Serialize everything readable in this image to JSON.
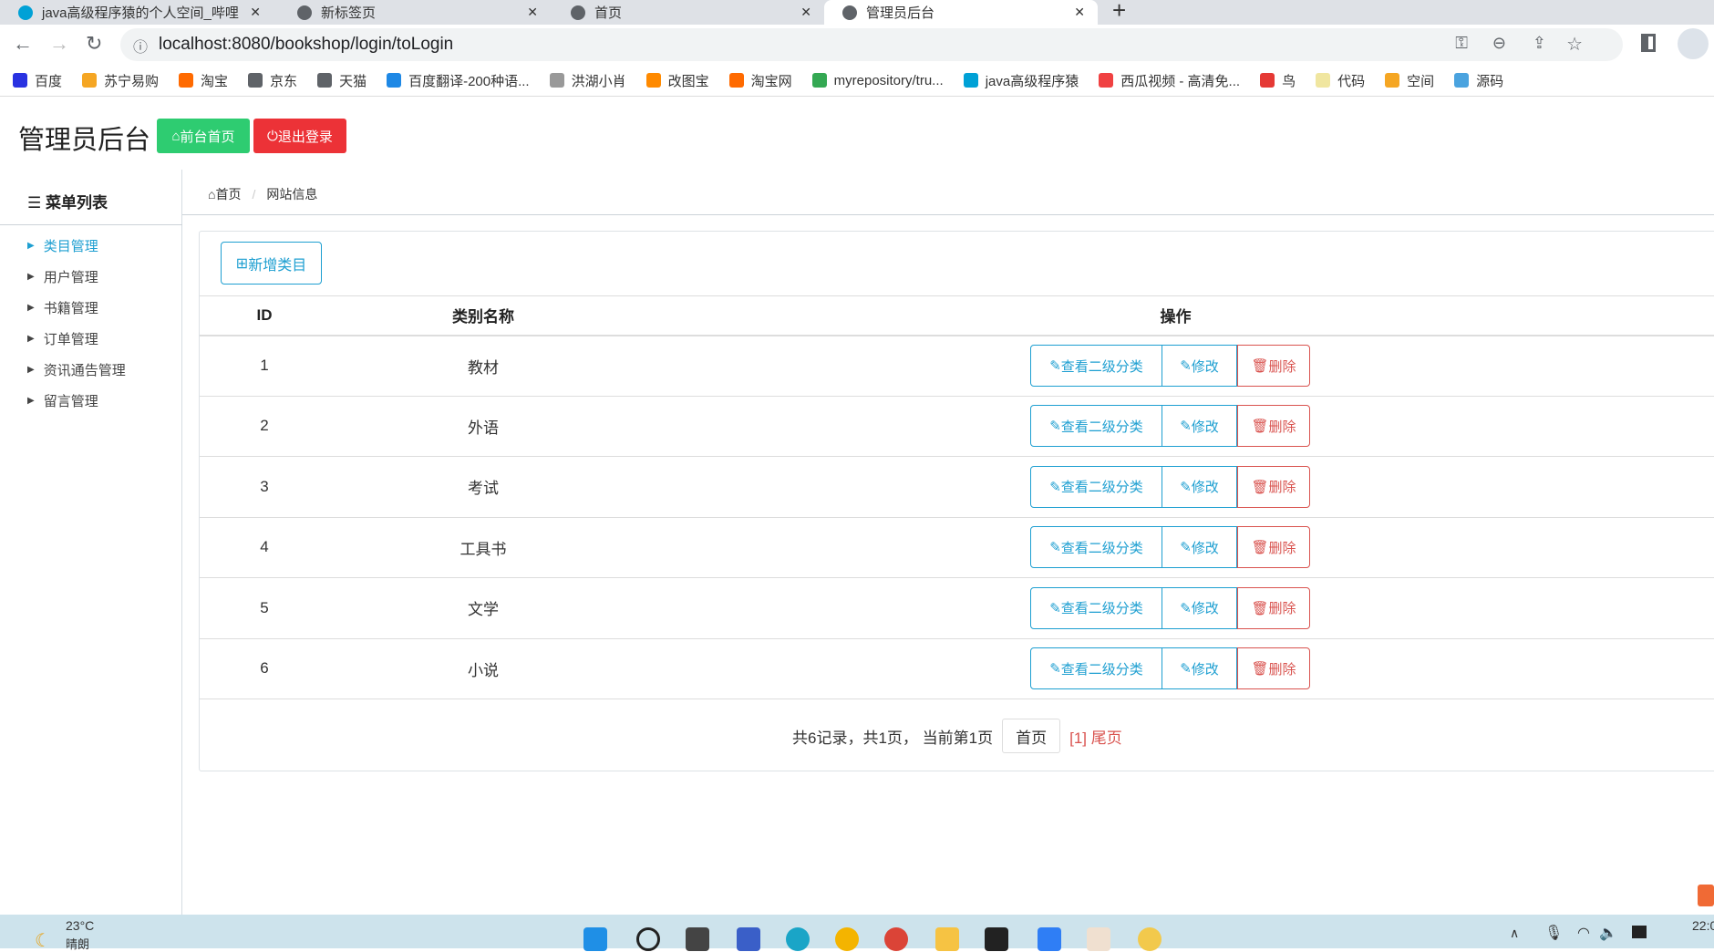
{
  "browser": {
    "tabs": [
      {
        "label": "java高级程序猿的个人空间_哔哩"
      },
      {
        "label": "新标签页"
      },
      {
        "label": "首页"
      },
      {
        "label": "管理员后台",
        "active": true
      }
    ],
    "url": "localhost:8080/bookshop/login/toLogin",
    "bookmarks": [
      {
        "label": "百度",
        "color": "#2932e1"
      },
      {
        "label": "苏宁易购",
        "color": "#f5a623"
      },
      {
        "label": "淘宝",
        "color": "#ff6a00"
      },
      {
        "label": "京东",
        "color": "#5f6368"
      },
      {
        "label": "天猫",
        "color": "#5f6368"
      },
      {
        "label": "百度翻译-200种语...",
        "color": "#1e88e5"
      },
      {
        "label": "洪湖小肖",
        "color": "#999999"
      },
      {
        "label": "改图宝",
        "color": "#ff8a00"
      },
      {
        "label": "淘宝网",
        "color": "#ff6a00"
      },
      {
        "label": "myrepository/tru...",
        "color": "#34a853"
      },
      {
        "label": "java高级程序猿",
        "color": "#00a1d6"
      },
      {
        "label": "西瓜视频 - 高清免...",
        "color": "#f04142"
      },
      {
        "label": "鸟",
        "color": "#e53935"
      },
      {
        "label": "代码",
        "color": "#f0e6a0"
      },
      {
        "label": "空间",
        "color": "#f5a623"
      },
      {
        "label": "源码",
        "color": "#4aa3df"
      }
    ]
  },
  "header": {
    "title": "管理员后台",
    "home_button": "前台首页",
    "logout_button": "退出登录"
  },
  "sidebar": {
    "heading": "菜单列表",
    "items": [
      {
        "label": "类目管理",
        "active": true
      },
      {
        "label": "用户管理"
      },
      {
        "label": "书籍管理"
      },
      {
        "label": "订单管理"
      },
      {
        "label": "资讯通告管理"
      },
      {
        "label": "留言管理"
      }
    ]
  },
  "breadcrumb": {
    "home": "首页",
    "current": "网站信息"
  },
  "main": {
    "add_button": "新增类目",
    "columns": [
      "ID",
      "类别名称",
      "操作"
    ],
    "rows": [
      {
        "id": "1",
        "name": "教材"
      },
      {
        "id": "2",
        "name": "外语"
      },
      {
        "id": "3",
        "name": "考试"
      },
      {
        "id": "4",
        "name": "工具书"
      },
      {
        "id": "5",
        "name": "文学"
      },
      {
        "id": "6",
        "name": "小说"
      }
    ],
    "actions": {
      "view": "查看二级分类",
      "edit": "修改",
      "delete": "删除"
    },
    "pagination": {
      "summary": "共6记录，共1页， 当前第1页",
      "first": "首页",
      "current": "[1]",
      "last": "尾页"
    }
  },
  "taskbar": {
    "temperature": "23°C",
    "weather": "晴朗",
    "time": "22:0"
  },
  "colors": {
    "primary": "#1e9fd1",
    "success": "#2ecc71",
    "danger": "#ec3237"
  }
}
